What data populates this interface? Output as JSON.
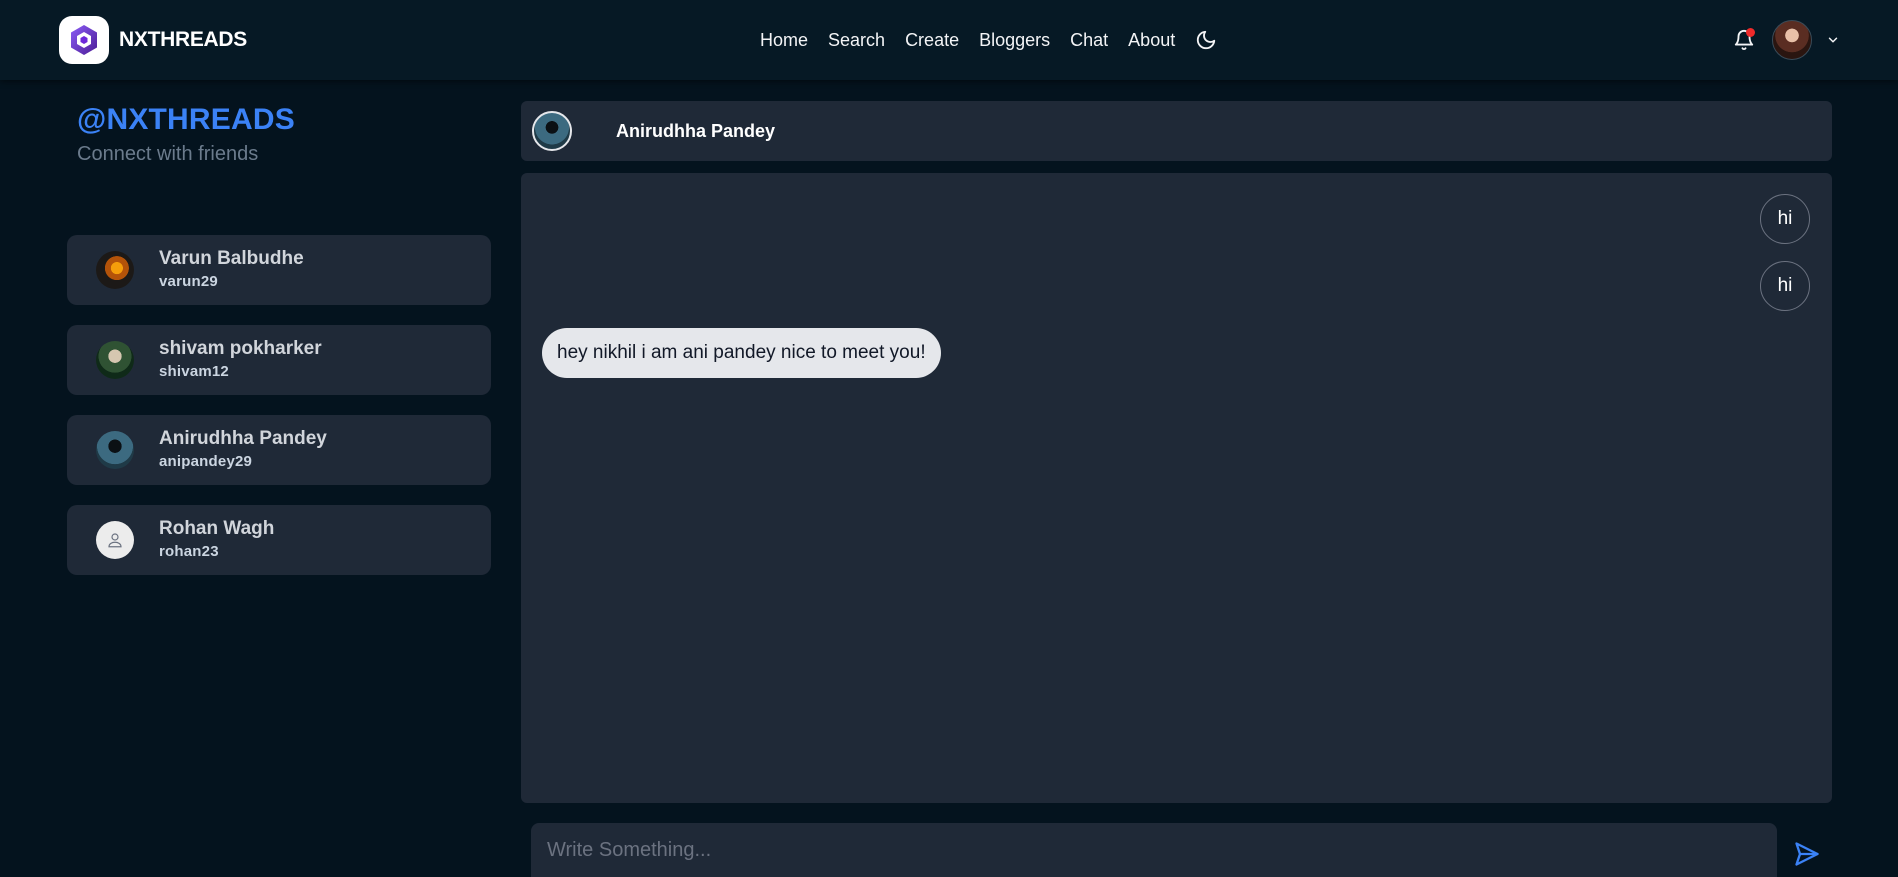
{
  "brand": {
    "name": "NXTHREADS",
    "logo_icon": "hexagon-logo-icon"
  },
  "nav": {
    "links": [
      "Home",
      "Search",
      "Create",
      "Bloggers",
      "Chat",
      "About"
    ],
    "theme_icon": "moon-icon",
    "notification_icon": "bell-icon",
    "notification_dot_color": "#ef2a2a",
    "menu_icon": "chevron-down-icon"
  },
  "sidebar": {
    "handle": "@NXTHREADS",
    "subtitle": "Connect with friends",
    "contacts": [
      {
        "name": "Varun Balbudhe",
        "username": "varun29"
      },
      {
        "name": "shivam pokharker",
        "username": "shivam12"
      },
      {
        "name": "Anirudhha Pandey",
        "username": "anipandey29"
      },
      {
        "name": "Rohan Wagh",
        "username": "rohan23"
      }
    ]
  },
  "chat": {
    "active_contact": "Anirudhha Pandey",
    "messages": [
      {
        "from": "me",
        "text": "hi"
      },
      {
        "from": "me",
        "text": "hi"
      },
      {
        "from": "them",
        "text": "hey nikhil i am ani pandey nice to meet you!"
      }
    ],
    "composer_placeholder": "Write Something...",
    "send_icon": "send-icon"
  },
  "colors": {
    "accent": "#3b82f6",
    "background": "#04131e",
    "panel": "#1f2937"
  }
}
